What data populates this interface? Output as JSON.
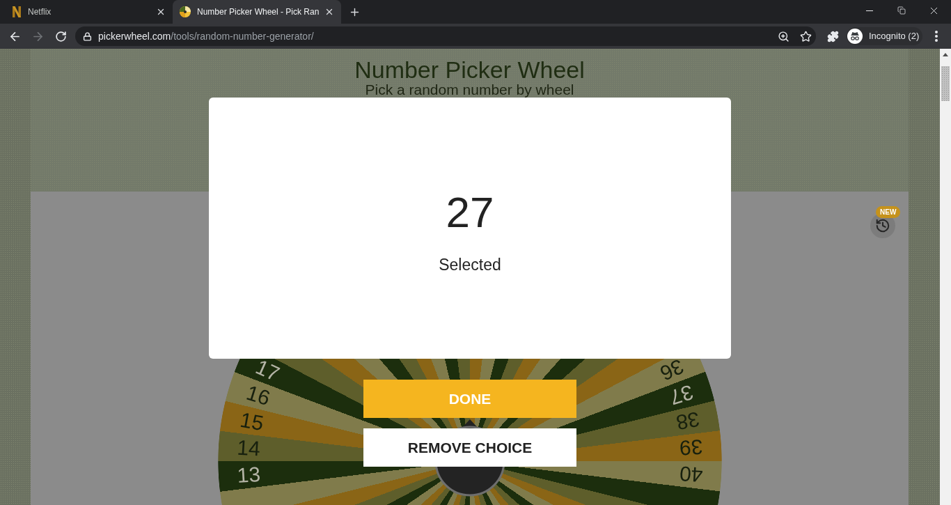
{
  "browser": {
    "tabs": [
      {
        "title": "Netflix",
        "selected": false
      },
      {
        "title": "Number Picker Wheel - Pick Ran",
        "selected": true
      }
    ],
    "navigation": {
      "forward_disabled": true
    },
    "address": {
      "domain": "pickerwheel.com",
      "path": "/tools/random-number-generator/"
    },
    "profile": {
      "label": "Incognito (2)"
    }
  },
  "page": {
    "title": "Number Picker Wheel",
    "subtitle": "Pick a random number by wheel",
    "history": {
      "badge": "NEW"
    }
  },
  "wheel": {
    "left_labels": [
      "17",
      "16",
      "15",
      "14",
      "13"
    ],
    "right_labels": [
      "36",
      "37",
      "38",
      "39",
      "40"
    ]
  },
  "dialog": {
    "result": "27",
    "caption": "Selected",
    "buttons": [
      {
        "label": "DONE",
        "kind": "primary"
      },
      {
        "label": "REMOVE CHOICE",
        "kind": "secondary"
      }
    ]
  }
}
